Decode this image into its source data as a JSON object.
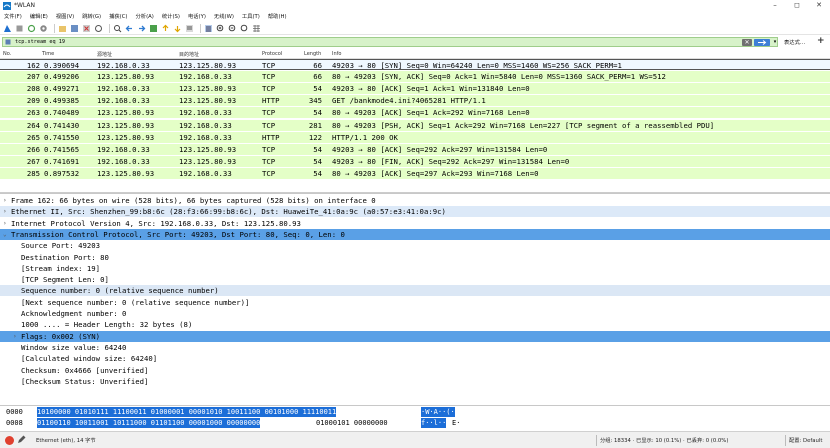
{
  "window": {
    "title": "*WLAN",
    "controls": {
      "minimize": "–",
      "maximize": "◻",
      "close": "✕"
    }
  },
  "menu": [
    "文件(F)",
    "编辑(E)",
    "视图(V)",
    "跳转(G)",
    "捕获(C)",
    "分析(A)",
    "统计(S)",
    "电话(Y)",
    "无线(W)",
    "工具(T)",
    "帮助(H)"
  ],
  "filter": {
    "value": "tcp.stream eq 19",
    "expression_label": "表达式…",
    "plus_label": "+",
    "clear_label": "✕"
  },
  "packet_list": {
    "columns": [
      "No.",
      "Time",
      "源地址",
      "目的地址",
      "Protocol",
      "Length",
      "Info"
    ],
    "rows": [
      {
        "no": "162",
        "time": "0.390694",
        "src": "192.168.0.33",
        "dst": "123.125.80.93",
        "proto": "TCP",
        "len": "66",
        "info": "49203 → 80 [SYN] Seq=0 Win=64240 Len=0 MSS=1460 WS=256 SACK_PERM=1"
      },
      {
        "no": "207",
        "time": "0.499206",
        "src": "123.125.80.93",
        "dst": "192.168.0.33",
        "proto": "TCP",
        "len": "66",
        "info": "80 → 49203 [SYN, ACK] Seq=0 Ack=1 Win=5840 Len=0 MSS=1360 SACK_PERM=1 WS=512"
      },
      {
        "no": "208",
        "time": "0.499271",
        "src": "192.168.0.33",
        "dst": "123.125.80.93",
        "proto": "TCP",
        "len": "54",
        "info": "49203 → 80 [ACK] Seq=1 Ack=1 Win=131840 Len=0"
      },
      {
        "no": "209",
        "time": "0.499385",
        "src": "192.168.0.33",
        "dst": "123.125.80.93",
        "proto": "HTTP",
        "len": "345",
        "info": "GET /bankmode4.ini?4065281 HTTP/1.1"
      },
      {
        "no": "263",
        "time": "0.740489",
        "src": "123.125.80.93",
        "dst": "192.168.0.33",
        "proto": "TCP",
        "len": "54",
        "info": "80 → 49203 [ACK] Seq=1 Ack=292 Win=7168 Len=0"
      },
      {
        "no": "264",
        "time": "0.741430",
        "src": "123.125.80.93",
        "dst": "192.168.0.33",
        "proto": "TCP",
        "len": "281",
        "info": "80 → 49203 [PSH, ACK] Seq=1 Ack=292 Win=7168 Len=227 [TCP segment of a reassembled PDU]"
      },
      {
        "no": "265",
        "time": "0.741550",
        "src": "123.125.80.93",
        "dst": "192.168.0.33",
        "proto": "HTTP",
        "len": "122",
        "info": "HTTP/1.1 200 OK"
      },
      {
        "no": "266",
        "time": "0.741565",
        "src": "192.168.0.33",
        "dst": "123.125.80.93",
        "proto": "TCP",
        "len": "54",
        "info": "49203 → 80 [ACK] Seq=292 Ack=297 Win=131584 Len=0"
      },
      {
        "no": "267",
        "time": "0.741691",
        "src": "192.168.0.33",
        "dst": "123.125.80.93",
        "proto": "TCP",
        "len": "54",
        "info": "49203 → 80 [FIN, ACK] Seq=292 Ack=297 Win=131584 Len=0"
      },
      {
        "no": "285",
        "time": "0.897532",
        "src": "123.125.80.93",
        "dst": "192.168.0.33",
        "proto": "TCP",
        "len": "54",
        "info": "80 → 49203 [ACK] Seq=297 Ack=293 Win=7168 Len=0"
      }
    ]
  },
  "details": [
    {
      "text": "Frame 162: 66 bytes on wire (528 bits), 66 bytes captured (528 bits) on interface 0",
      "arrow": "›"
    },
    {
      "text": "Ethernet II, Src: Shenzhen_99:b8:6c (28:f3:66:99:b8:6c), Dst: HuaweiTe_41:0a:9c (a0:57:e3:41:0a:9c)",
      "arrow": "›"
    },
    {
      "text": "Internet Protocol Version 4, Src: 192.168.0.33, Dst: 123.125.80.93",
      "arrow": "›"
    },
    {
      "text": "Transmission Control Protocol, Src Port: 49203, Dst Port: 80, Seq: 0, Len: 0",
      "arrow": "⌄"
    },
    {
      "text": "Source Port: 49203",
      "arrow": ""
    },
    {
      "text": "Destination Port: 80",
      "arrow": ""
    },
    {
      "text": "[Stream index: 19]",
      "arrow": ""
    },
    {
      "text": "[TCP Segment Len: 0]",
      "arrow": ""
    },
    {
      "text": "Sequence number: 0    (relative sequence number)",
      "arrow": ""
    },
    {
      "text": "[Next sequence number: 0    (relative sequence number)]",
      "arrow": ""
    },
    {
      "text": "Acknowledgment number: 0",
      "arrow": ""
    },
    {
      "text": "1000 .... = Header Length: 32 bytes (8)",
      "arrow": ""
    },
    {
      "text": "Flags: 0x002 (SYN)",
      "arrow": "›"
    },
    {
      "text": "Window size value: 64240",
      "arrow": ""
    },
    {
      "text": "[Calculated window size: 64240]",
      "arrow": ""
    },
    {
      "text": "Checksum: 0x4666 [unverified]",
      "arrow": ""
    },
    {
      "text": "[Checksum Status: Unverified]",
      "arrow": ""
    }
  ],
  "bytes": [
    {
      "offset": "0000",
      "selected": "10100000 01010111 11100011 01000001 00001010 10011100 00101000 11110011",
      "rest": "",
      "ascii_sel": "·W·A··(·",
      "ascii_rest": ""
    },
    {
      "offset": "0008",
      "selected": "01100110 10011001 10111000 01101100 00001000 00000000",
      "rest": "01000101 00000000",
      "ascii_sel": "f··l··",
      "ascii_rest": "E·"
    }
  ],
  "status": {
    "interface": "Ethernet (eth), 14 字节",
    "packets": "分组: 18334 · 已显示: 10 (0.1%) · 已丢弃: 0 (0.0%)",
    "profile": "配置: Default"
  }
}
